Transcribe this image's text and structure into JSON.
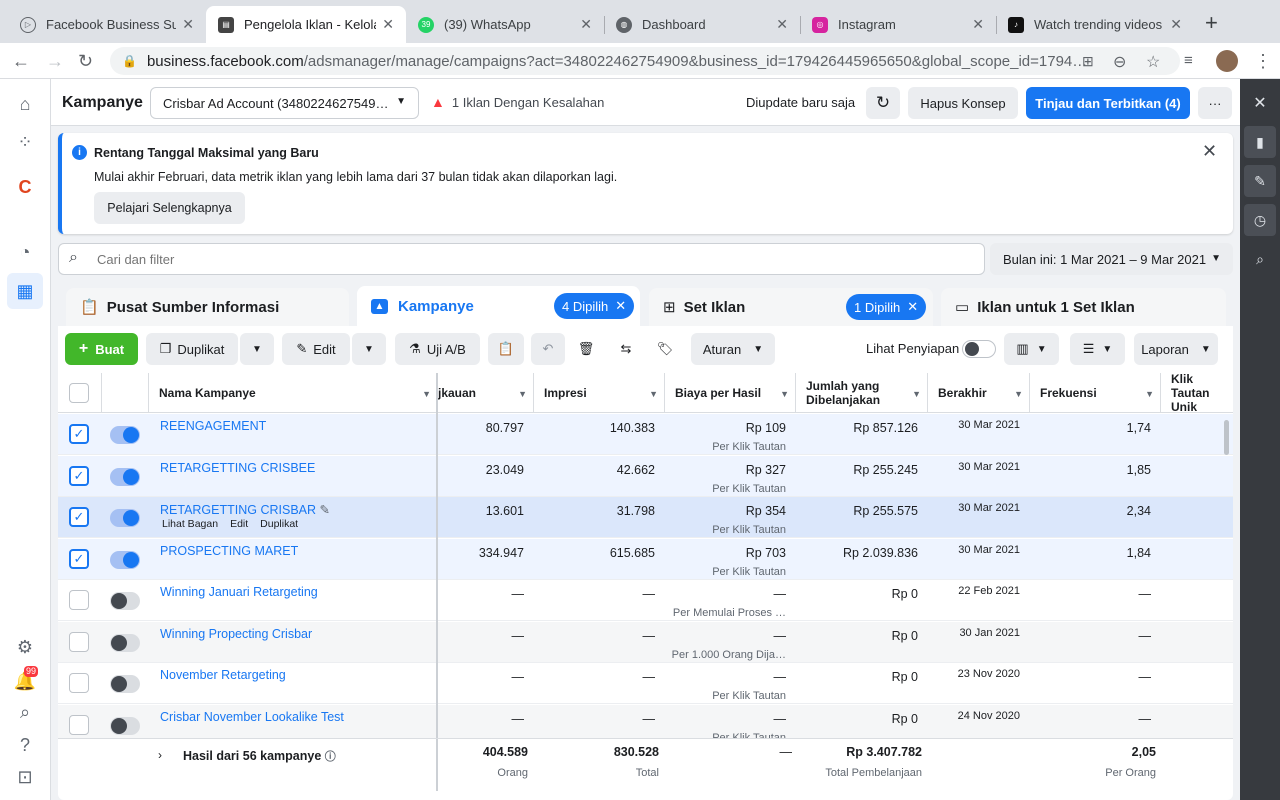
{
  "browser": {
    "tabs": [
      {
        "title": "Facebook Business Suit",
        "icon": "business-suite-icon"
      },
      {
        "title": "Pengelola Iklan - Kelola",
        "icon": "ads-manager-icon"
      },
      {
        "title": "(39) WhatsApp",
        "icon": "whatsapp-icon",
        "badge": "39"
      },
      {
        "title": "Dashboard",
        "icon": "globe-icon"
      },
      {
        "title": "Instagram",
        "icon": "instagram-icon"
      },
      {
        "title": "Watch trending videos f",
        "icon": "tiktok-icon"
      }
    ],
    "new_tab": "+",
    "url_host": "business.facebook.com",
    "url_path": "/adsmanager/manage/campaigns?act=348022462754909&business_id=179426445965650&global_scope_id=1794…"
  },
  "leftnav": {
    "badge": "99"
  },
  "header": {
    "title": "Kampanye",
    "account": "Crisbar Ad Account (3480224627549…",
    "error_text": "1 Iklan Dengan Kesalahan",
    "updated": "Diupdate baru saja",
    "discard": "Hapus Konsep",
    "publish": "Tinjau dan Terbitkan (4)",
    "more": "···"
  },
  "notice": {
    "title": "Rentang Tanggal Maksimal yang Baru",
    "body": "Mulai akhir Februari, data metrik iklan yang lebih lama dari 37 bulan tidak akan dilaporkan lagi.",
    "button": "Pelajari Selengkapnya"
  },
  "search": {
    "placeholder": "Cari dan filter"
  },
  "daterange": "Bulan ini: 1 Mar 2021 – 9 Mar 2021",
  "panel_tabs": {
    "resources": "Pusat Sumber Informasi",
    "campaigns": "Kampanye",
    "campaigns_pill": "4 Dipilih",
    "adsets": "Set Iklan",
    "adsets_pill": "1 Dipilih",
    "ads": "Iklan untuk 1 Set Iklan"
  },
  "toolbar": {
    "create": "Buat",
    "duplicate": "Duplikat",
    "edit": "Edit",
    "ab_test": "Uji A/B",
    "rules": "Aturan",
    "preview": "Lihat Penyiapan",
    "report": "Laporan"
  },
  "columns": {
    "name": "Nama Kampanye",
    "reach": "jkauan",
    "impressions": "Impresi",
    "cost_per_result": "Biaya per Hasil",
    "amount_spent": "Jumlah yang Dibelanjakan",
    "ends": "Berakhir",
    "frequency": "Frekuensi",
    "unique_clicks": "Klik Tautan Unik"
  },
  "rows": [
    {
      "name": "REENGAGEMENT",
      "checked": true,
      "on": true,
      "reach": "80.797",
      "impressions": "140.383",
      "cpr": "Rp 109",
      "cpr_sub": "Per Klik Tautan",
      "spent": "Rp 857.126",
      "ends": "30 Mar 2021",
      "freq": "1,74"
    },
    {
      "name": "RETARGETTING CRISBEE",
      "checked": true,
      "on": true,
      "reach": "23.049",
      "impressions": "42.662",
      "cpr": "Rp 327",
      "cpr_sub": "Per Klik Tautan",
      "spent": "Rp 255.245",
      "ends": "30 Mar 2021",
      "freq": "1,85"
    },
    {
      "name": "RETARGETTING CRISBAR",
      "checked": true,
      "on": true,
      "reach": "13.601",
      "impressions": "31.798",
      "cpr": "Rp 354",
      "cpr_sub": "Per Klik Tautan",
      "spent": "Rp 255.575",
      "ends": "30 Mar 2021",
      "freq": "2,34",
      "actions": [
        "Lihat Bagan",
        "Edit",
        "Duplikat"
      ]
    },
    {
      "name": "PROSPECTING MARET",
      "checked": true,
      "on": true,
      "reach": "334.947",
      "impressions": "615.685",
      "cpr": "Rp 703",
      "cpr_sub": "Per Klik Tautan",
      "spent": "Rp 2.039.836",
      "ends": "30 Mar 2021",
      "freq": "1,84"
    },
    {
      "name": "Winning Januari Retargeting",
      "checked": false,
      "on": false,
      "reach": "—",
      "impressions": "—",
      "cpr": "—",
      "cpr_sub": "Per Memulai Proses …",
      "spent": "Rp 0",
      "ends": "22 Feb 2021",
      "freq": "—"
    },
    {
      "name": "Winning Propecting Crisbar",
      "checked": false,
      "on": false,
      "reach": "—",
      "impressions": "—",
      "cpr": "—",
      "cpr_sub": "Per 1.000 Orang Dija…",
      "spent": "Rp 0",
      "ends": "30 Jan 2021",
      "freq": "—"
    },
    {
      "name": "November Retargeting",
      "checked": false,
      "on": false,
      "reach": "—",
      "impressions": "—",
      "cpr": "—",
      "cpr_sub": "Per Klik Tautan",
      "spent": "Rp 0",
      "ends": "23 Nov 2020",
      "freq": "—"
    },
    {
      "name": "Crisbar November Lookalike Test",
      "checked": false,
      "on": false,
      "reach": "—",
      "impressions": "—",
      "cpr": "—",
      "cpr_sub": "Per Klik Tautan",
      "spent": "Rp 0",
      "ends": "24 Nov 2020",
      "freq": "—"
    }
  ],
  "footer": {
    "label": "Hasil dari 56 kampanye",
    "reach": "404.589",
    "reach_sub": "Orang",
    "impressions": "830.528",
    "impressions_sub": "Total",
    "cpr": "—",
    "spent": "Rp 3.407.782",
    "spent_sub": "Total Pembelanjaan",
    "freq": "2,05",
    "freq_sub": "Per Orang"
  },
  "colors": {
    "accent": "#1877f2",
    "create": "#42b72a",
    "error": "#fa383e"
  }
}
